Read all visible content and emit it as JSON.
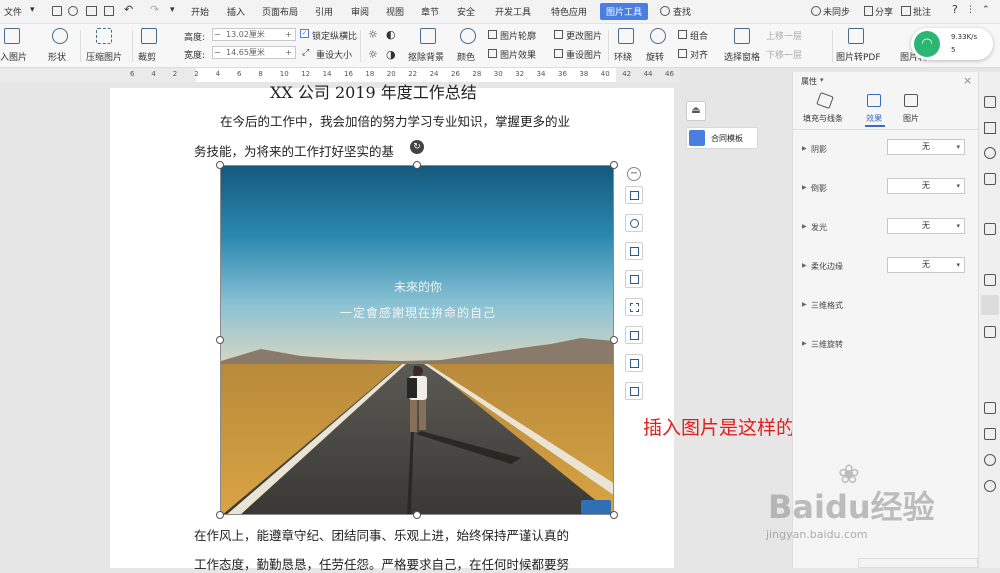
{
  "menubar": {
    "file": "文件",
    "tabs": [
      "开始",
      "插入",
      "页面布局",
      "引用",
      "审阅",
      "视图",
      "章节",
      "安全",
      "开发工具",
      "特色应用",
      "图片工具"
    ],
    "search": "查找",
    "sync": "未同步",
    "share": "分享",
    "comment": "批注"
  },
  "ribbon": {
    "insert_picture": "入图片",
    "shape": "形状",
    "compress": "压缩图片",
    "crop": "裁剪",
    "height_label": "高度:",
    "height_value": "13.02厘米",
    "width_label": "宽度:",
    "width_value": "14.65厘米",
    "lock_ratio": "锁定纵横比",
    "reset_size": "重设大小",
    "cutout": "抠除背景",
    "color": "颜色",
    "outline": "图片轮廓",
    "effect": "图片效果",
    "change": "更改图片",
    "reset": "重设图片",
    "wrap": "环绕",
    "rotate": "旋转",
    "group": "组合",
    "align": "对齐",
    "selection_pane": "选择窗格",
    "bring_forward": "上移一层",
    "send_backward": "下移一层",
    "to_pdf": "图片转PDF",
    "convert": "图片转"
  },
  "network": {
    "speed": "9.33K/s",
    "count": "5"
  },
  "ruler": {
    "ticks": [
      "6",
      "4",
      "2",
      "2",
      "4",
      "6",
      "8",
      "10",
      "12",
      "14",
      "16",
      "18",
      "20",
      "22",
      "24",
      "26",
      "28",
      "30",
      "32",
      "34",
      "36",
      "38",
      "40",
      "42",
      "44",
      "46"
    ]
  },
  "document": {
    "title": "XX 公司 2019 年度工作总结",
    "para1_line1": "在今后的工作中，我会加倍的努力学习专业知识，掌握更多的业",
    "para1_line2": "务技能，为将来的工作打好坚实的基",
    "image_text1": "未來的你",
    "image_text2": "一定會感謝現在拚命的自己",
    "para2_line1": "在作风上，能遵章守纪、团结同事、乐观上进，始终保持严谨认真的",
    "para2_line2": "工作态度，勤勤恳恳，任劳任怨。严格要求自己，在任何时候都要努"
  },
  "floating": {
    "template": "合同模板"
  },
  "annotation": "插入图片是这样的",
  "panel": {
    "title": "属性",
    "tabs": [
      "填充与线条",
      "效果",
      "图片"
    ],
    "rows": [
      {
        "label": "阴影",
        "value": "无"
      },
      {
        "label": "倒影",
        "value": "无"
      },
      {
        "label": "发光",
        "value": "无"
      },
      {
        "label": "柔化边缘",
        "value": "无"
      }
    ],
    "sections": [
      "三维格式",
      "三维旋转"
    ]
  },
  "watermark": {
    "brand": "Baidu经验",
    "url": "jingyan.baidu.com"
  },
  "colors": {
    "accent": "#4a7ee0",
    "annotation": "#e02020",
    "network_badge": "#2bb673"
  }
}
